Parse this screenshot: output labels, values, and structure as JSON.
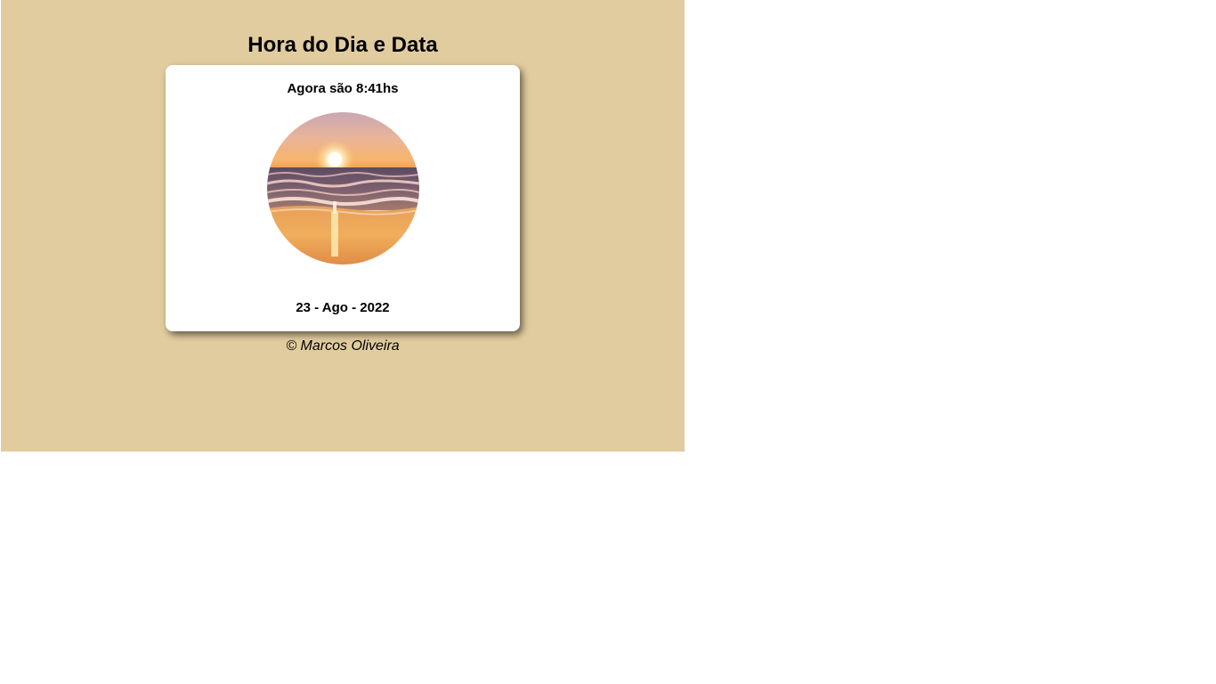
{
  "page": {
    "title": "Hora do Dia e Data",
    "background_color": "#e1cc9f"
  },
  "card": {
    "time_text": "Agora são 8:41hs",
    "photo_icon": "sunset-beach-image",
    "date_text": "23 - Ago - 2022"
  },
  "footer": {
    "copyright": "© Marcos Oliveira"
  }
}
